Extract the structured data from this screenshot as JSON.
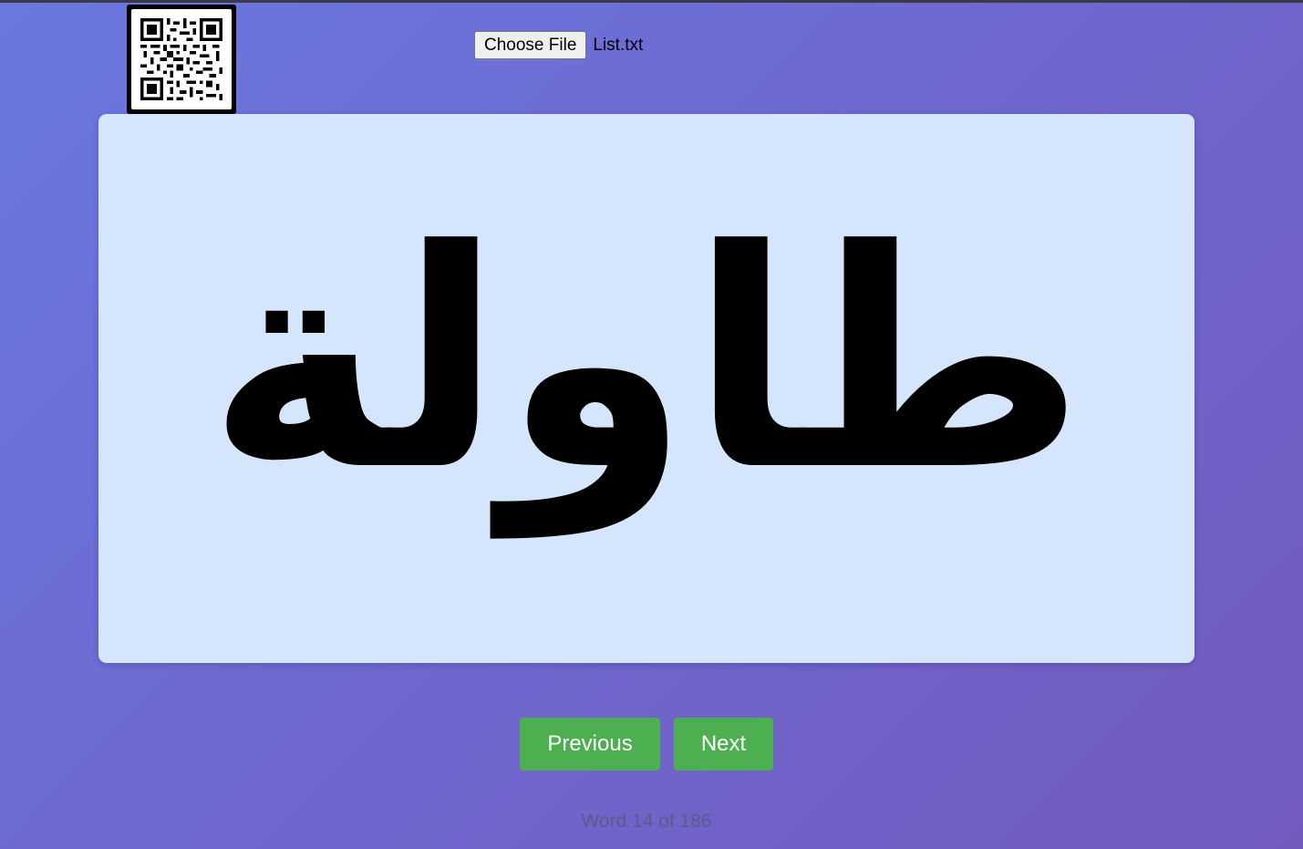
{
  "file_picker": {
    "button_label": "Choose File",
    "file_name": "List.txt"
  },
  "qr_code": {
    "icon": "qr-code-icon"
  },
  "flashcard": {
    "word": "طاولة"
  },
  "navigation": {
    "previous_label": "Previous",
    "next_label": "Next"
  },
  "counter": {
    "text": "Word 14 of 186",
    "current": 14,
    "total": 186
  },
  "colors": {
    "background_start": "#6a78e0",
    "background_end": "#735bbe",
    "card_background": "#d4e5fc",
    "button_green": "#4caf50",
    "counter_text": "#5d5a8a"
  }
}
